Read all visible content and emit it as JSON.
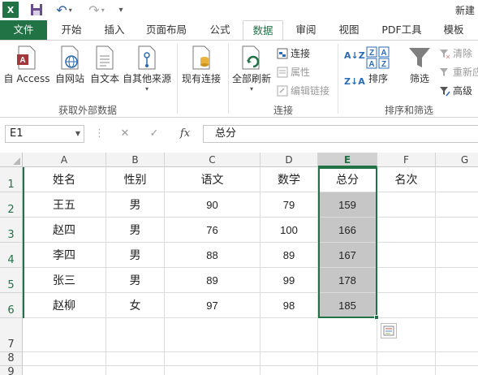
{
  "app": {
    "logo_text": "X",
    "doc_title": "新建"
  },
  "tabs": [
    "文件",
    "开始",
    "插入",
    "页面布局",
    "公式",
    "数据",
    "审阅",
    "视图",
    "PDF工具",
    "模板"
  ],
  "active_tab": "数据",
  "ribbon": {
    "get_external": {
      "access": "自 Access",
      "web": "自网站",
      "text": "自文本",
      "other": "自其他来源",
      "group_label": "获取外部数据"
    },
    "existing": "现有连接",
    "connections": {
      "refresh_all": "全部刷新",
      "connections": "连接",
      "properties": "属性",
      "edit_links": "编辑链接",
      "group_label": "连接"
    },
    "sort_filter": {
      "sort": "排序",
      "filter": "筛选",
      "clear": "清除",
      "reapply": "重新应",
      "advanced": "高级",
      "group_label": "排序和筛选"
    }
  },
  "formula_bar": {
    "name_box": "E1",
    "fx": "fx",
    "content": "总分"
  },
  "sheet": {
    "columns": [
      "A",
      "B",
      "C",
      "D",
      "E",
      "F",
      "G"
    ],
    "selected_column": "E",
    "row_numbers": [
      "1",
      "2",
      "3",
      "4",
      "5",
      "6",
      "7",
      "8",
      "9"
    ],
    "headers": [
      "姓名",
      "性别",
      "语文",
      "数学",
      "总分",
      "名次"
    ],
    "rows": [
      [
        "王五",
        "男",
        "90",
        "79",
        "159",
        ""
      ],
      [
        "赵四",
        "男",
        "76",
        "100",
        "166",
        ""
      ],
      [
        "李四",
        "男",
        "88",
        "89",
        "167",
        ""
      ],
      [
        "张三",
        "男",
        "89",
        "99",
        "178",
        ""
      ],
      [
        "赵柳",
        "女",
        "97",
        "98",
        "185",
        ""
      ]
    ]
  }
}
